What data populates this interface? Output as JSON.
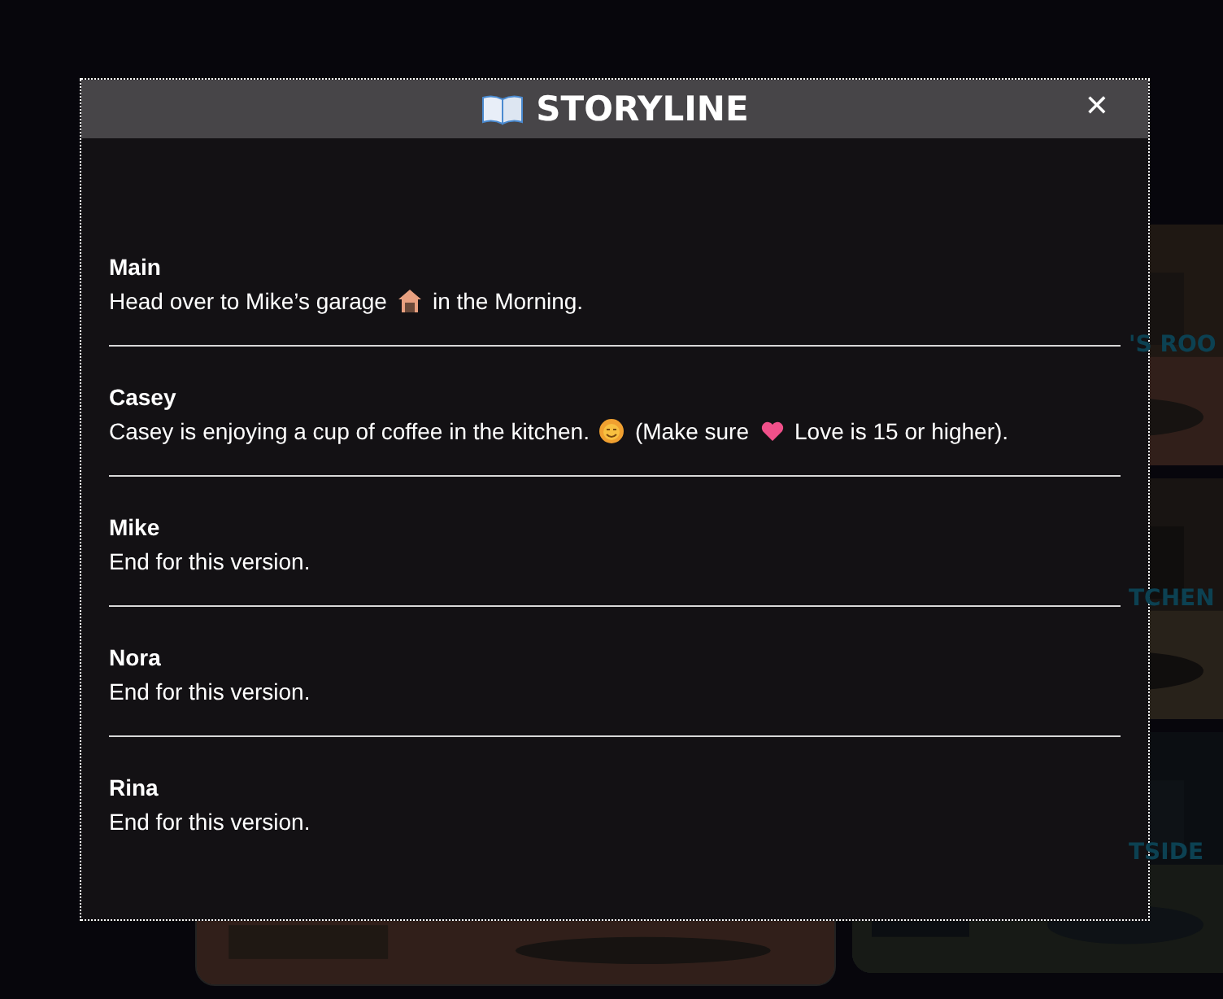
{
  "background_cards": [
    {
      "kind": "picture",
      "label": "'S ROO"
    },
    {
      "kind": "picture",
      "label": "TCHEN"
    },
    {
      "kind": "picture",
      "label": "TSIDE"
    }
  ],
  "dialog": {
    "title": "STORYLINE",
    "close": "✕",
    "entries": [
      {
        "name": "Main",
        "text": [
          {
            "kind": "text",
            "text": "Head over to Mike’s garage"
          },
          {
            "kind": "house"
          },
          {
            "kind": "text",
            "text": "in the Morning."
          }
        ]
      },
      {
        "name": "Casey",
        "text": [
          {
            "kind": "text",
            "text": "Casey is enjoying a cup of coffee in the kitchen."
          },
          {
            "kind": "smiley"
          },
          {
            "kind": "text",
            "text": "(Make sure"
          },
          {
            "kind": "heart"
          },
          {
            "kind": "text",
            "text": "Love is 15 or higher)."
          }
        ]
      },
      {
        "name": "Mike",
        "text": [
          {
            "kind": "text",
            "text": "End for this version."
          }
        ]
      },
      {
        "name": "Nora",
        "text": [
          {
            "kind": "text",
            "text": "End for this version."
          }
        ]
      },
      {
        "name": "Rina",
        "text": [
          {
            "kind": "text",
            "text": "End for this version."
          }
        ]
      }
    ]
  }
}
